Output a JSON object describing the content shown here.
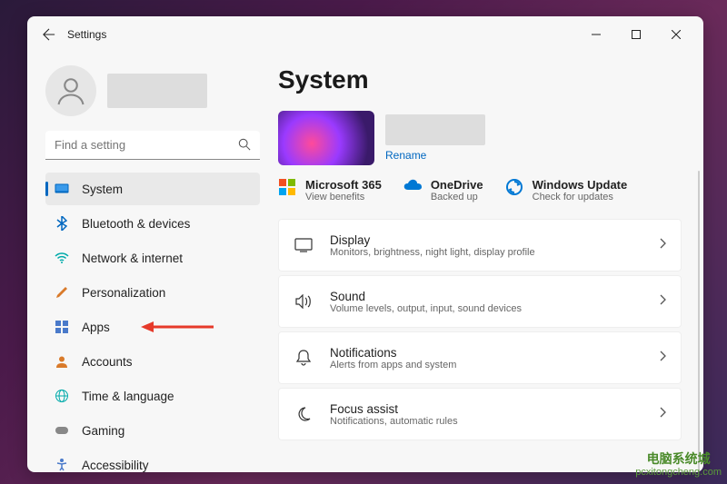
{
  "window": {
    "title": "Settings"
  },
  "search": {
    "placeholder": "Find a setting"
  },
  "sidebar": {
    "items": [
      {
        "label": "System"
      },
      {
        "label": "Bluetooth & devices"
      },
      {
        "label": "Network & internet"
      },
      {
        "label": "Personalization"
      },
      {
        "label": "Apps"
      },
      {
        "label": "Accounts"
      },
      {
        "label": "Time & language"
      },
      {
        "label": "Gaming"
      },
      {
        "label": "Accessibility"
      }
    ]
  },
  "main": {
    "title": "System",
    "rename": "Rename",
    "status": [
      {
        "title": "Microsoft 365",
        "sub": "View benefits"
      },
      {
        "title": "OneDrive",
        "sub": "Backed up"
      },
      {
        "title": "Windows Update",
        "sub": "Check for updates"
      }
    ],
    "settings": [
      {
        "title": "Display",
        "sub": "Monitors, brightness, night light, display profile"
      },
      {
        "title": "Sound",
        "sub": "Volume levels, output, input, sound devices"
      },
      {
        "title": "Notifications",
        "sub": "Alerts from apps and system"
      },
      {
        "title": "Focus assist",
        "sub": "Notifications, automatic rules"
      }
    ]
  },
  "watermark": {
    "line1": "电脑系统城",
    "line2": "pcxitongcheng.com"
  }
}
